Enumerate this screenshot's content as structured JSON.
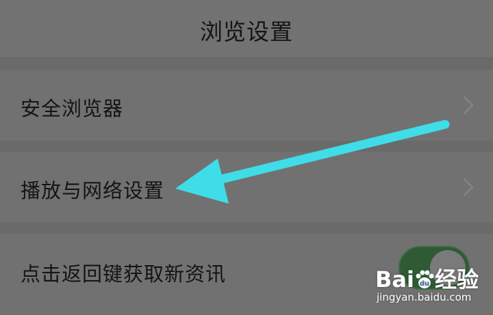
{
  "header": {
    "title": "浏览设置"
  },
  "settings": {
    "items": [
      {
        "label": "安全浏览器",
        "control": "chevron"
      },
      {
        "label": "播放与网络设置",
        "control": "chevron"
      },
      {
        "label": "点击返回键获取新资讯",
        "control": "toggle",
        "toggle_on": true
      }
    ]
  },
  "annotation": {
    "arrow_color": "#3fdde8",
    "target": "播放与网络设置"
  },
  "watermark": {
    "brand": "Bai du 经验",
    "brand_left": "Bai",
    "brand_right": "经验",
    "paw_text": "du",
    "site": "jingyan.baidu.com"
  },
  "colors": {
    "background": "#6f6f6f",
    "text": "#141414",
    "toggle_on": "#2f5a34"
  },
  "icons": {
    "chevron": "chevron-right-icon",
    "paw": "baidu-paw-icon"
  }
}
